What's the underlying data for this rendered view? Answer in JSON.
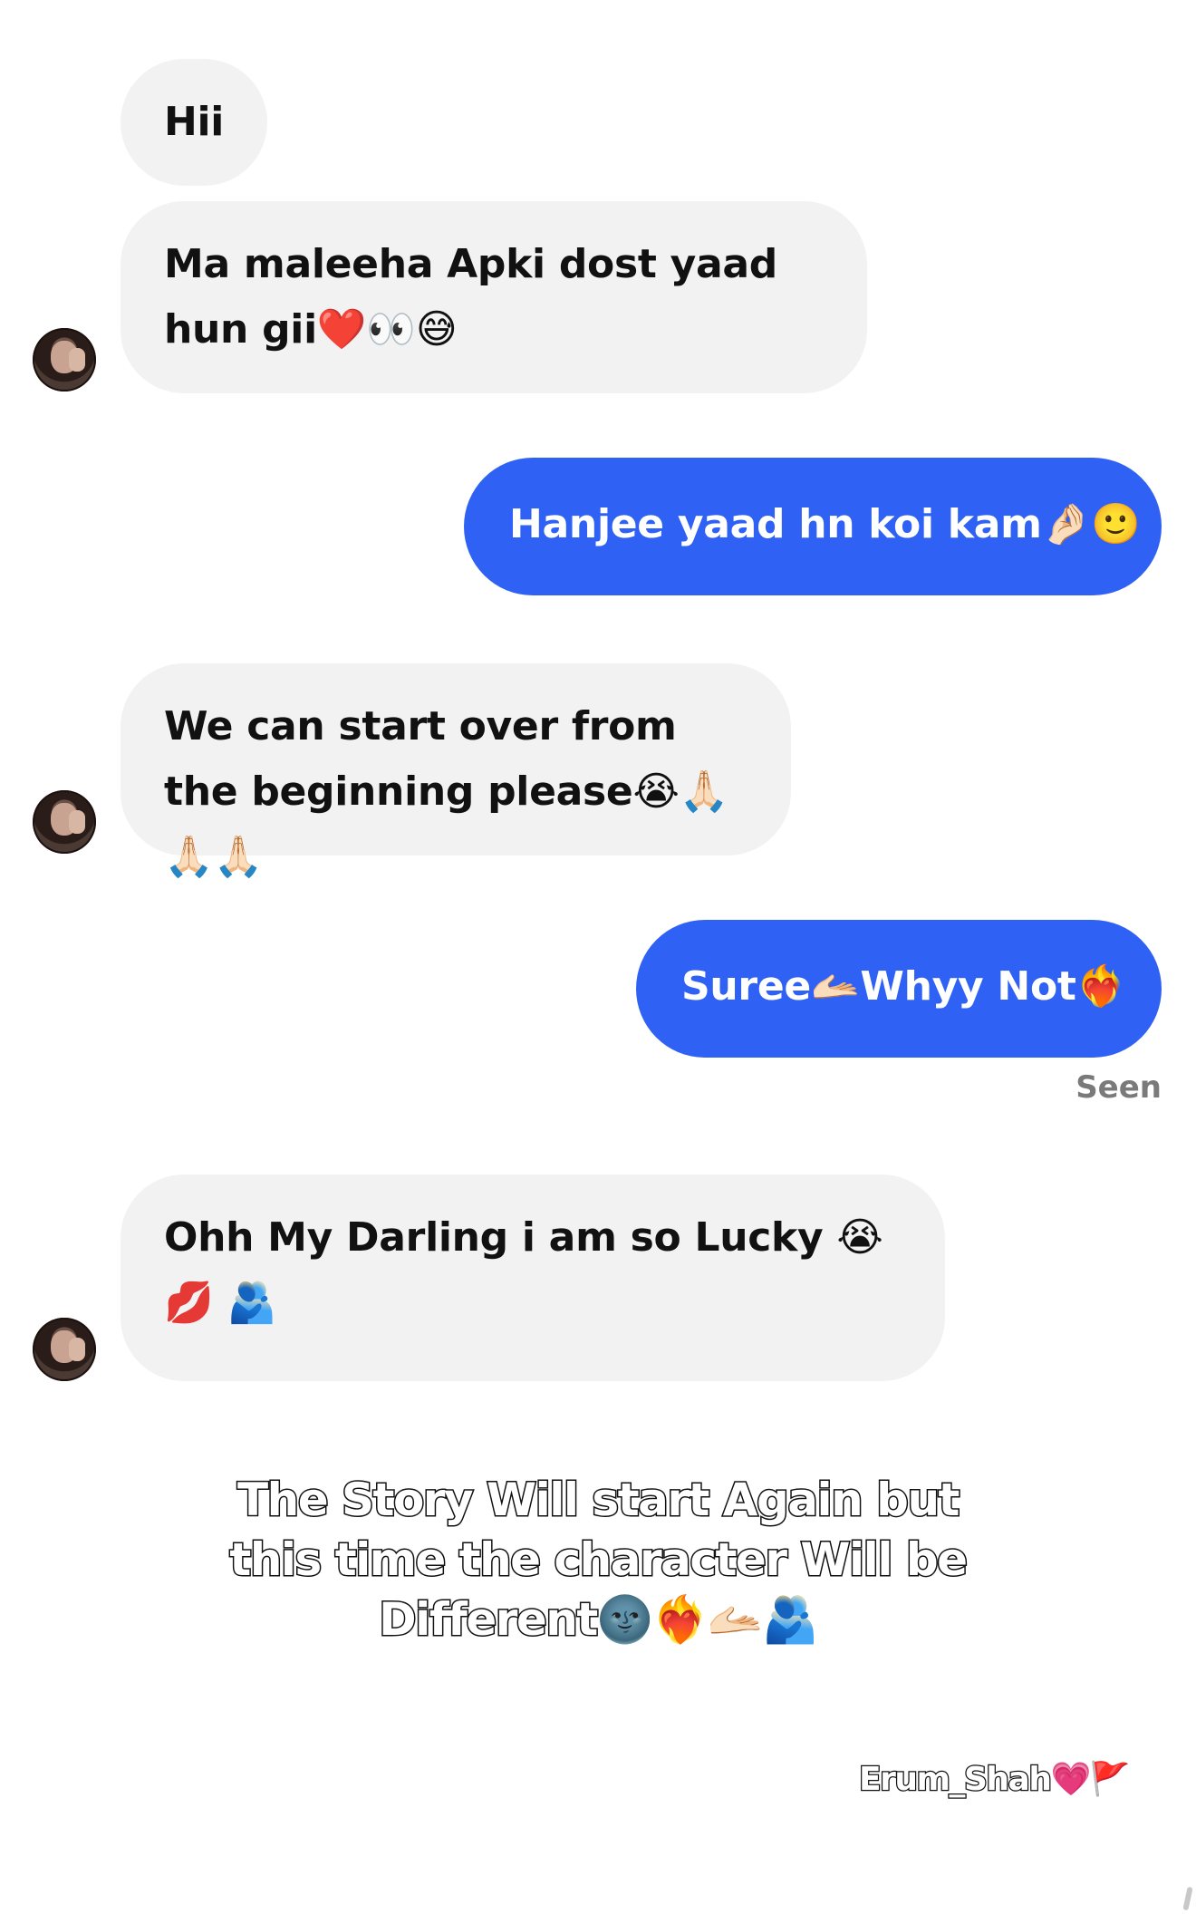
{
  "conversation": {
    "messages": [
      {
        "direction": "incoming",
        "text": "Hii",
        "show_avatar": false
      },
      {
        "direction": "incoming",
        "text": "Ma maleeha Apki dost yaad hun gii❤️👀😅",
        "show_avatar": true
      },
      {
        "direction": "outgoing",
        "text": "Hanjee yaad hn koi kam🤌🏻🙂"
      },
      {
        "direction": "incoming",
        "text": "We can start over from the beginning please😭🙏🏻🙏🏻🙏🏻",
        "show_avatar": true
      },
      {
        "direction": "outgoing",
        "text": "Suree🫴🏻Whyy Not❤️‍🔥"
      },
      {
        "direction": "incoming",
        "text": "Ohh My Darling i am so Lucky 😭💋 🫂",
        "show_avatar": true
      }
    ],
    "seen_label": "Seen"
  },
  "overlay": {
    "caption": "The Story Will start Again but this time the character Will be Different🌚❤️‍🔥🫴🏻🫂",
    "signature": "Erum_Shah💗🚩"
  },
  "colors": {
    "incoming_bubble": "#f2f2f3",
    "outgoing_bubble": "#2f62f4",
    "seen_text": "#7a7a7a"
  }
}
